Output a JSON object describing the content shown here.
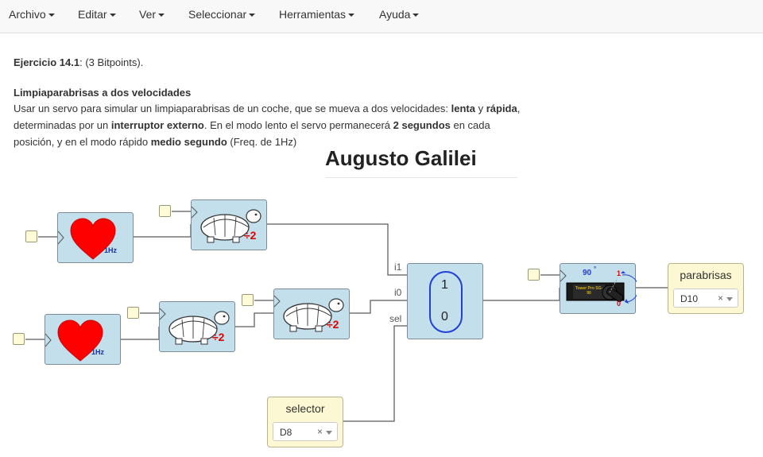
{
  "menu": {
    "items": [
      {
        "label": "Archivo"
      },
      {
        "label": "Editar"
      },
      {
        "label": "Ver"
      },
      {
        "label": "Seleccionar"
      },
      {
        "label": "Herramientas"
      },
      {
        "label": "Ayuda"
      }
    ]
  },
  "description": {
    "exercise_label": "Ejercicio 14.1",
    "exercise_points": ": (3 Bitpoints).",
    "heading": "Limpiaparabrisas a dos velocidades",
    "line1_a": "Usar un servo para simular un limpiaparabrisas de un coche, que se mueva a dos velocidades: ",
    "line1_b": "lenta",
    "line1_c": " y ",
    "line1_d": "rápida",
    "line1_e": ",",
    "line2_a": "determinadas por un ",
    "line2_b": "interruptor externo",
    "line2_c": ". En el modo lento el servo permanecerá ",
    "line2_d": "2 segundos",
    "line2_e": " en cada",
    "line3_a": "posición, y en el modo rápido ",
    "line3_b": "medio segundo",
    "line3_c": " (Freq. de 1Hz)"
  },
  "title": "Augusto Galilei",
  "blocks": {
    "heart_freq": "1Hz",
    "divider_label": "÷2",
    "mux_top": "1",
    "mux_bottom": "0",
    "mux_inputs": {
      "i1": "i1",
      "i0": "i0",
      "sel": "sel"
    },
    "servo_angle": "90",
    "servo_degree": "°",
    "servo_one": "1",
    "servo_zero": "0",
    "servo_brand": "Tower Pro SG-90"
  },
  "io": {
    "parabrisas": {
      "name": "parabrisas",
      "value": "D10",
      "clear": "×"
    },
    "selector": {
      "name": "selector",
      "value": "D8",
      "clear": "×"
    }
  },
  "colors": {
    "block_fill": "#c2dfeb",
    "io_fill": "#fcf8d3",
    "heart": "#ff0000",
    "mux_oval": "#1f3fd6",
    "divider_red": "#e00000"
  }
}
